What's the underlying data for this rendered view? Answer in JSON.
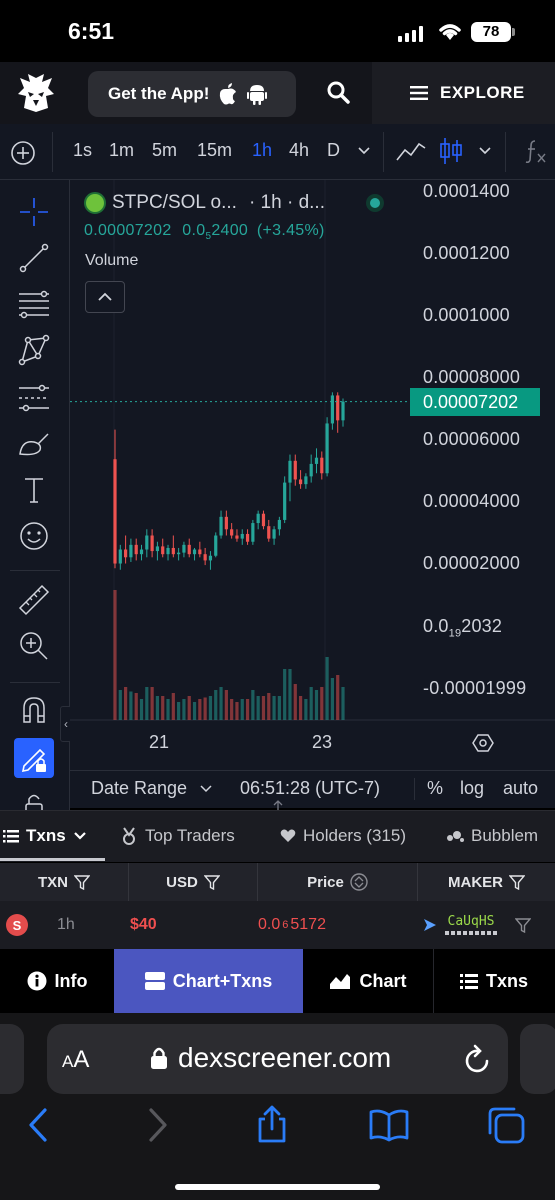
{
  "status": {
    "time": "6:51",
    "battery": "78"
  },
  "header": {
    "get_app": "Get the App!",
    "explore": "EXPLORE"
  },
  "intervals": [
    "1s",
    "1m",
    "5m",
    "15m",
    "1h",
    "4h",
    "D"
  ],
  "active_interval": "1h",
  "chart": {
    "symbol": "STPC/SOL o...",
    "interval_source": "· 1h · d...",
    "price": "0.00007202",
    "change_prefix": "0.0",
    "change_sub": "5",
    "change_rest": "2400",
    "change_pct": "(+3.45%)",
    "volume_label": "Volume",
    "price_axis": [
      "0.0001400",
      "0.0001200",
      "0.0001000",
      "0.00008000",
      "0.00006000",
      "0.00004000",
      "0.00002000",
      "0.0",
      "-0.00001999"
    ],
    "price_axis_sub": "19",
    "price_axis_sub_rest": "2032",
    "last_price_tag": "0.00007202",
    "time_axis": [
      "21",
      "23"
    ]
  },
  "chart_data": {
    "type": "candlestick",
    "x_axis_labels": [
      "21",
      "23"
    ],
    "ylim": [
      -1.999e-05,
      0.00014
    ],
    "last_price": 7.202e-05,
    "candles": [
      {
        "o": 5.35e-05,
        "h": 6.3e-05,
        "l": 1.85e-05,
        "c": 2e-05
      },
      {
        "o": 2e-05,
        "h": 2.6e-05,
        "l": 1.8e-05,
        "c": 2.45e-05
      },
      {
        "o": 2.45e-05,
        "h": 2.9e-05,
        "l": 2e-05,
        "c": 2.2e-05
      },
      {
        "o": 2.2e-05,
        "h": 2.8e-05,
        "l": 2.05e-05,
        "c": 2.6e-05
      },
      {
        "o": 2.6e-05,
        "h": 2.8e-05,
        "l": 2.1e-05,
        "c": 2.3e-05
      },
      {
        "o": 2.3e-05,
        "h": 2.6e-05,
        "l": 2.1e-05,
        "c": 2.45e-05
      },
      {
        "o": 2.45e-05,
        "h": 3.1e-05,
        "l": 2.2e-05,
        "c": 2.9e-05
      },
      {
        "o": 2.9e-05,
        "h": 3.1e-05,
        "l": 2.2e-05,
        "c": 2.4e-05
      },
      {
        "o": 2.4e-05,
        "h": 2.7e-05,
        "l": 2.1e-05,
        "c": 2.55e-05
      },
      {
        "o": 2.55e-05,
        "h": 2.8e-05,
        "l": 2.2e-05,
        "c": 2.3e-05
      },
      {
        "o": 2.3e-05,
        "h": 2.6e-05,
        "l": 2.1e-05,
        "c": 2.5e-05
      },
      {
        "o": 2.5e-05,
        "h": 2.9e-05,
        "l": 2.2e-05,
        "c": 2.3e-05
      },
      {
        "o": 2.3e-05,
        "h": 2.5e-05,
        "l": 2.1e-05,
        "c": 2.35e-05
      },
      {
        "o": 2.35e-05,
        "h": 2.7e-05,
        "l": 2.2e-05,
        "c": 2.6e-05
      },
      {
        "o": 2.6e-05,
        "h": 2.8e-05,
        "l": 2.2e-05,
        "c": 2.3e-05
      },
      {
        "o": 2.3e-05,
        "h": 2.5e-05,
        "l": 2.1e-05,
        "c": 2.45e-05
      },
      {
        "o": 2.45e-05,
        "h": 2.7e-05,
        "l": 2.2e-05,
        "c": 2.3e-05
      },
      {
        "o": 2.3e-05,
        "h": 2.5e-05,
        "l": 1.95e-05,
        "c": 2.1e-05
      },
      {
        "o": 2.1e-05,
        "h": 2.4e-05,
        "l": 1.8e-05,
        "c": 2.25e-05
      },
      {
        "o": 2.25e-05,
        "h": 3e-05,
        "l": 2.2e-05,
        "c": 2.9e-05
      },
      {
        "o": 2.9e-05,
        "h": 3.7e-05,
        "l": 2.8e-05,
        "c": 3.5e-05
      },
      {
        "o": 3.5e-05,
        "h": 3.7e-05,
        "l": 2.9e-05,
        "c": 3.1e-05
      },
      {
        "o": 3.1e-05,
        "h": 3.3e-05,
        "l": 2.8e-05,
        "c": 2.9e-05
      },
      {
        "o": 2.9e-05,
        "h": 3.1e-05,
        "l": 2.7e-05,
        "c": 2.8e-05
      },
      {
        "o": 2.8e-05,
        "h": 3.1e-05,
        "l": 2.6e-05,
        "c": 2.95e-05
      },
      {
        "o": 2.95e-05,
        "h": 3.1e-05,
        "l": 2.6e-05,
        "c": 2.7e-05
      },
      {
        "o": 2.7e-05,
        "h": 3.4e-05,
        "l": 2.6e-05,
        "c": 3.3e-05
      },
      {
        "o": 3.3e-05,
        "h": 3.7e-05,
        "l": 3.1e-05,
        "c": 3.6e-05
      },
      {
        "o": 3.6e-05,
        "h": 3.7e-05,
        "l": 3.1e-05,
        "c": 3.2e-05
      },
      {
        "o": 3.2e-05,
        "h": 3.4e-05,
        "l": 2.7e-05,
        "c": 2.8e-05
      },
      {
        "o": 2.8e-05,
        "h": 3.2e-05,
        "l": 2.6e-05,
        "c": 3.1e-05
      },
      {
        "o": 3.1e-05,
        "h": 3.5e-05,
        "l": 2.9e-05,
        "c": 3.4e-05
      },
      {
        "o": 3.4e-05,
        "h": 4.8e-05,
        "l": 3.3e-05,
        "c": 4.6e-05
      },
      {
        "o": 4.6e-05,
        "h": 5.5e-05,
        "l": 4e-05,
        "c": 5.3e-05
      },
      {
        "o": 5.3e-05,
        "h": 5.5e-05,
        "l": 4.5e-05,
        "c": 4.7e-05
      },
      {
        "o": 4.7e-05,
        "h": 5e-05,
        "l": 4.4e-05,
        "c": 4.55e-05
      },
      {
        "o": 4.55e-05,
        "h": 4.9e-05,
        "l": 4.4e-05,
        "c": 4.8e-05
      },
      {
        "o": 4.8e-05,
        "h": 5.5e-05,
        "l": 4.6e-05,
        "c": 5.2e-05
      },
      {
        "o": 5.2e-05,
        "h": 5.7e-05,
        "l": 4.9e-05,
        "c": 5.4e-05
      },
      {
        "o": 5.4e-05,
        "h": 5.6e-05,
        "l": 4.7e-05,
        "c": 4.9e-05
      },
      {
        "o": 4.9e-05,
        "h": 6.7e-05,
        "l": 4.8e-05,
        "c": 6.5e-05
      },
      {
        "o": 6.5e-05,
        "h": 7.5e-05,
        "l": 6.3e-05,
        "c": 7.4e-05
      },
      {
        "o": 7.4e-05,
        "h": 7.5e-05,
        "l": 6.2e-05,
        "c": 6.6e-05
      },
      {
        "o": 6.6e-05,
        "h": 7.3e-05,
        "l": 6.4e-05,
        "c": 7.202e-05
      }
    ]
  },
  "range_bar": {
    "date_range": "Date Range",
    "clock": "06:51:28 (UTC-7)",
    "percent": "%",
    "log": "log",
    "auto": "auto"
  },
  "dex_tabs": {
    "txns": "Txns",
    "top_traders": "Top Traders",
    "holders": "Holders (315)",
    "bubblemaps": "Bubblem"
  },
  "table": {
    "headers": {
      "txn": "TXN",
      "usd": "USD",
      "price": "Price",
      "maker": "MAKER"
    },
    "row": {
      "type": "S",
      "age": "1h",
      "usd": "$40",
      "price_prefix": "0.0",
      "price_sub": "6",
      "price_rest": "5172",
      "maker": "CaUqHS"
    }
  },
  "views": {
    "info": "Info",
    "chart_txns": "Chart+Txns",
    "chart": "Chart",
    "txns": "Txns"
  },
  "browser": {
    "aa_small": "A",
    "aa_large": "A",
    "url": "dexscreener.com"
  },
  "colors": {
    "up": "#26a69a",
    "down": "#ef5350",
    "accent": "#2962ff",
    "active_view": "#4b56c0"
  }
}
